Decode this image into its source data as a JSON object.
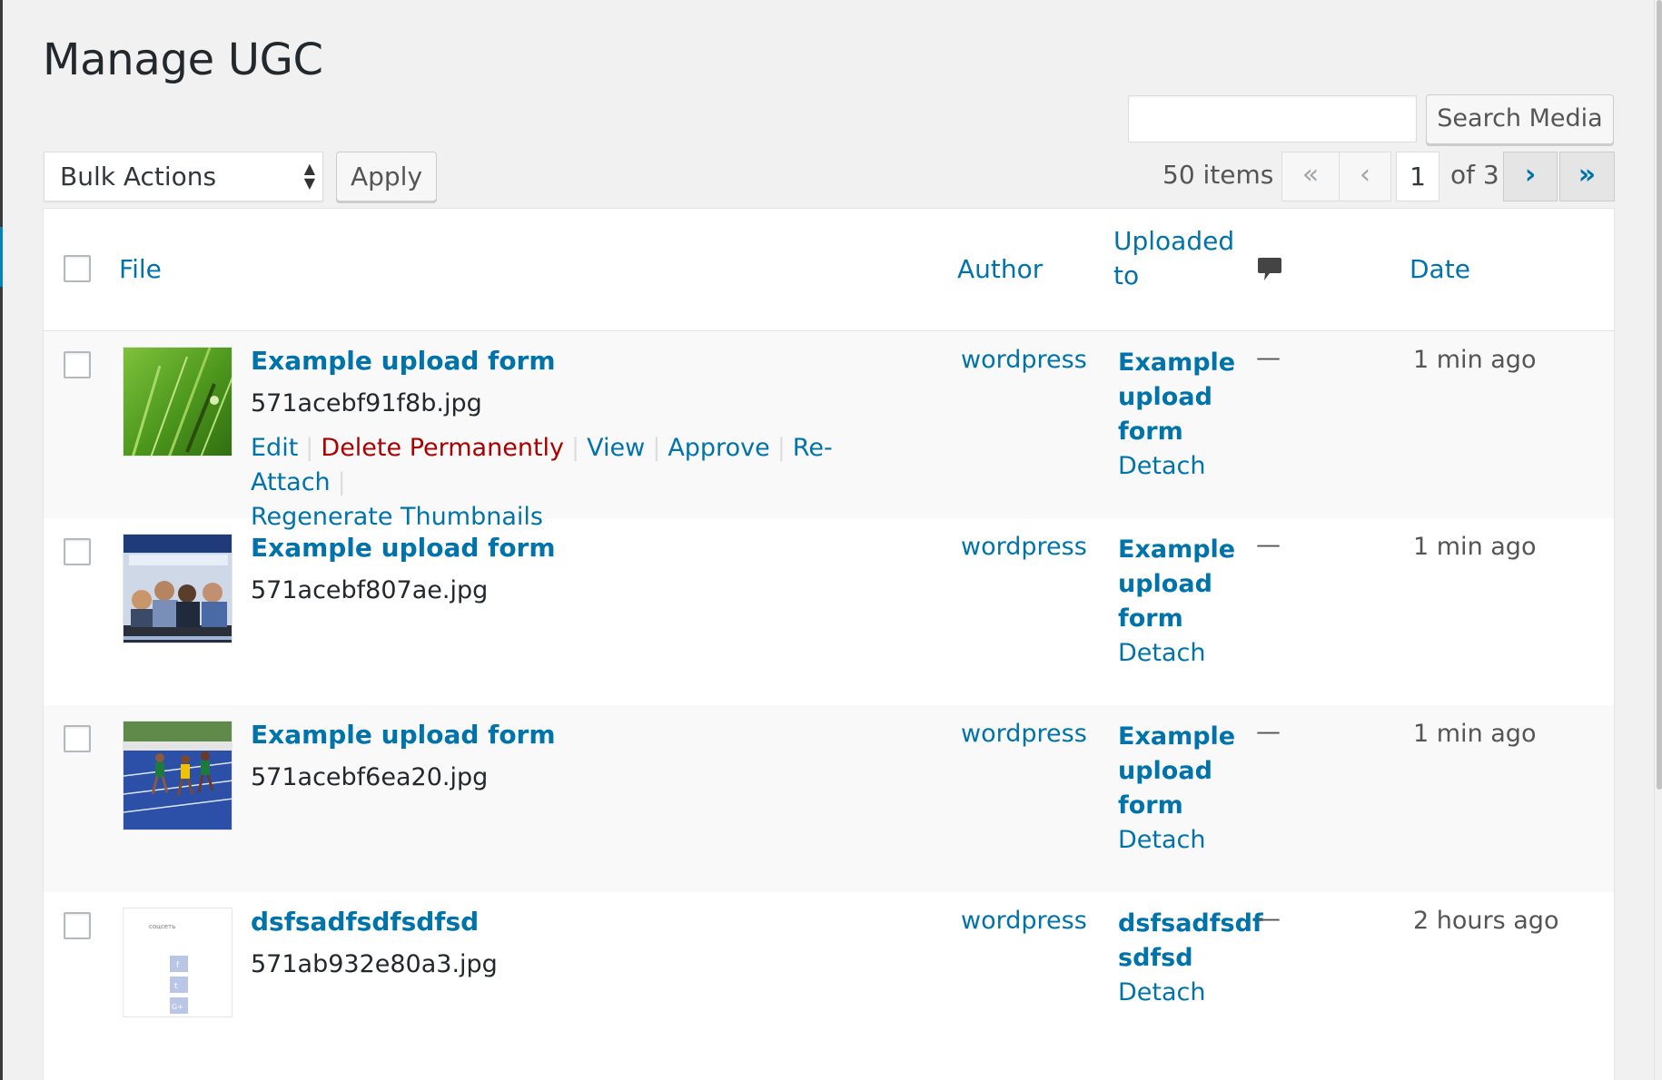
{
  "page": {
    "title": "Manage UGC"
  },
  "search": {
    "placeholder": "",
    "button_label": "Search Media"
  },
  "bulk": {
    "selected": "Bulk Actions",
    "apply_label": "Apply"
  },
  "pagination": {
    "items_count": "50 items",
    "first": "«",
    "prev": "‹",
    "current_page": "1",
    "of_label": "of 3",
    "next": "›",
    "last": "»"
  },
  "table": {
    "headers": {
      "file": "File",
      "author": "Author",
      "uploaded_to_line1": "Uploaded",
      "uploaded_to_line2": "to",
      "comments_icon": "comment-icon",
      "date": "Date"
    },
    "rows": [
      {
        "title": "Example upload form",
        "filename": "571acebf91f8b.jpg",
        "thumbnail_icon": "grass-photo",
        "actions": {
          "edit": "Edit",
          "delete": "Delete Permanently",
          "view": "View",
          "approve": "Approve",
          "reattach": "Re-Attach",
          "regenerate": "Regenerate Thumbnails"
        },
        "author": "wordpress",
        "uploaded_title_lines": [
          "Example",
          "upload",
          "form"
        ],
        "detach": "Detach",
        "comments": "—",
        "date": "1 min ago"
      },
      {
        "title": "Example upload form",
        "filename": "571acebf807ae.jpg",
        "thumbnail_icon": "people-photo",
        "author": "wordpress",
        "uploaded_title_lines": [
          "Example",
          "upload",
          "form"
        ],
        "detach": "Detach",
        "comments": "—",
        "date": "1 min ago"
      },
      {
        "title": "Example upload form",
        "filename": "571acebf6ea20.jpg",
        "thumbnail_icon": "runners-photo",
        "author": "wordpress",
        "uploaded_title_lines": [
          "Example",
          "upload",
          "form"
        ],
        "detach": "Detach",
        "comments": "—",
        "date": "1 min ago"
      },
      {
        "title": "dsfsadfsdfsdfsd",
        "filename": "571ab932e80a3.jpg",
        "thumbnail_icon": "social-widget-screenshot",
        "thumbnail_caption": "соцсеть",
        "author": "wordpress",
        "uploaded_title_lines": [
          "dsfsadfsdf",
          "sdfsd"
        ],
        "detach": "Detach",
        "comments": "—",
        "date": "2 hours ago"
      }
    ]
  },
  "colors": {
    "link": "#0073aa",
    "danger": "#a00",
    "background": "#f1f1f1"
  }
}
